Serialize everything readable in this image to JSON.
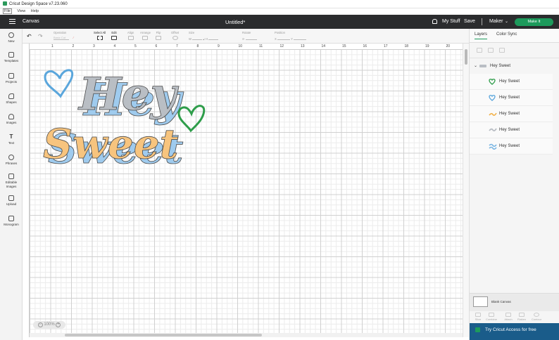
{
  "window": {
    "title": "Cricut Design Space  v7.23.060"
  },
  "menu": [
    "File",
    "View",
    "Help"
  ],
  "header": {
    "section": "Canvas",
    "document_title": "Untitled*",
    "my_stuff": "My Stuff",
    "save": "Save",
    "machine": "Maker",
    "make_it": "Make It"
  },
  "toolbar": {
    "operation": "Operation",
    "operation_value": "Basic Cut",
    "select_all": "Select All",
    "edit": "Edit",
    "align": "Align",
    "arrange": "Arrange",
    "flip": "Flip",
    "offset": "Offset",
    "size": "Size",
    "size_w": "W",
    "size_h": "H",
    "rotate": "Rotate",
    "position": "Position",
    "pos_x": "X",
    "pos_y": "Y"
  },
  "sidebar": [
    {
      "label": "New",
      "icon": "plus-icon"
    },
    {
      "label": "Templates",
      "icon": "shirt-icon"
    },
    {
      "label": "Projects",
      "icon": "projects-icon"
    },
    {
      "label": "Shapes",
      "icon": "shapes-icon"
    },
    {
      "label": "Images",
      "icon": "bulb-icon"
    },
    {
      "label": "Text",
      "icon": "text-icon"
    },
    {
      "label": "Phrases",
      "icon": "phrases-icon"
    },
    {
      "label": "Editable Images",
      "icon": "editable-images-icon"
    },
    {
      "label": "Upload",
      "icon": "upload-icon"
    },
    {
      "label": "Monogram",
      "icon": "monogram-icon"
    }
  ],
  "ruler": {
    "x_ticks": [
      "1",
      "2",
      "3",
      "4",
      "5",
      "6",
      "7",
      "8",
      "9",
      "10",
      "11",
      "12",
      "13",
      "14",
      "15",
      "16",
      "17",
      "18",
      "19",
      "20"
    ]
  },
  "canvas": {
    "zoom": "100%",
    "design_text": [
      "Hey",
      "Sweet"
    ],
    "colors": {
      "gray": "#b9bec4",
      "blue": "#9fcbee",
      "yellow": "#f7c47e",
      "green": "#2e9d4a"
    }
  },
  "panel": {
    "tab_layers": "Layers",
    "tab_color_sync": "Color Sync",
    "group_name": "Hey Sweet",
    "layers": [
      {
        "name": "Hey Sweet",
        "icon": "green-heart-icon",
        "color": "#2e9d4a"
      },
      {
        "name": "Hey Sweet",
        "icon": "blue-heart-icon",
        "color": "#7ab6e3"
      },
      {
        "name": "Hey Sweet",
        "icon": "yellow-text-icon",
        "color": "#f2b24c"
      },
      {
        "name": "Hey Sweet",
        "icon": "gray-text-icon",
        "color": "#b9bec4"
      },
      {
        "name": "Hey Sweet",
        "icon": "blue-text-icon",
        "color": "#7ab6e3"
      }
    ],
    "blank_canvas": "Blank Canvas",
    "bottom_tools": [
      "Slice",
      "Combine",
      "Attach",
      "Flatten",
      "Contour"
    ],
    "access": "Try Cricut Access for free"
  }
}
